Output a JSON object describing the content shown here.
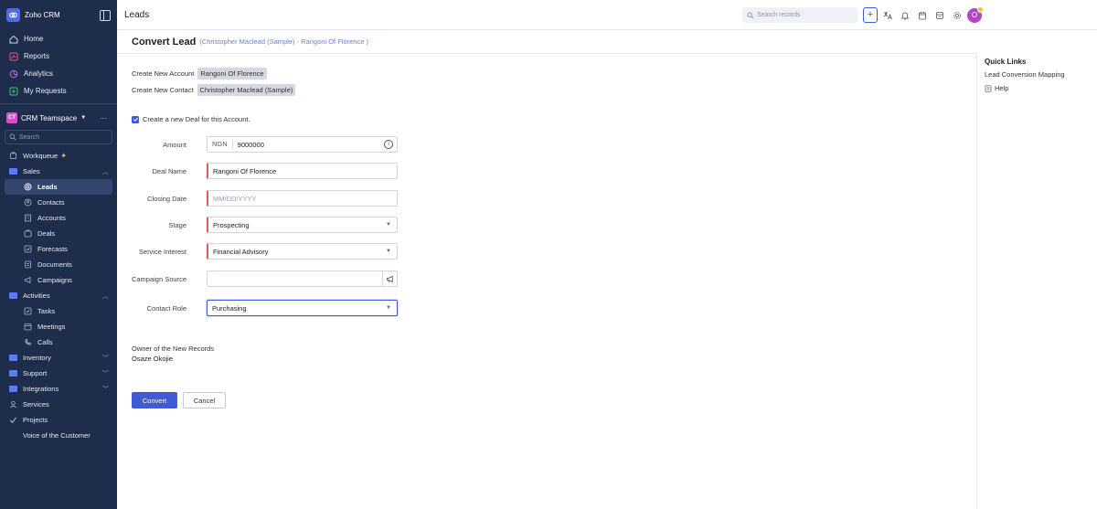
{
  "app": {
    "name": "Zoho CRM",
    "module_title": "Leads"
  },
  "nav": {
    "top_items": [
      {
        "label": "Home",
        "icon": "home-icon"
      },
      {
        "label": "Reports",
        "icon": "reports-icon"
      },
      {
        "label": "Analytics",
        "icon": "analytics-icon"
      },
      {
        "label": "My Requests",
        "icon": "requests-icon"
      }
    ],
    "teamspace": {
      "badge": "CT",
      "name": "CRM Teamspace"
    },
    "search_placeholder": "Search",
    "workqueue": "Workqueue",
    "sales": {
      "label": "Sales",
      "items": [
        "Leads",
        "Contacts",
        "Accounts",
        "Deals",
        "Forecasts",
        "Documents",
        "Campaigns"
      ],
      "active": "Leads"
    },
    "activities": {
      "label": "Activities",
      "items": [
        "Tasks",
        "Meetings",
        "Calls"
      ]
    },
    "groups": [
      "Inventory",
      "Support",
      "Integrations"
    ],
    "bottom": [
      "Services",
      "Projects",
      "Voice of the Customer"
    ]
  },
  "topbar": {
    "search_placeholder": "Search records",
    "avatar_initial": "O"
  },
  "header": {
    "title": "Convert Lead",
    "subtitle": "(Christopher Maclead (Sample) - Rangoni Of Florence )"
  },
  "quick_links": {
    "title": "Quick Links",
    "items": [
      "Lead Conversion Mapping",
      "Help"
    ]
  },
  "convert": {
    "account_label": "Create New Account",
    "account_value": "Rangoni Of Florence",
    "contact_label": "Create New Contact",
    "contact_value": "Christopher Maclead (Sample)",
    "deal_checkbox_label": "Create a new Deal for this Account.",
    "deal_checked": true,
    "fields": {
      "amount": {
        "label": "Amount",
        "currency": "NGN",
        "value": "9000000"
      },
      "deal_name": {
        "label": "Deal Name",
        "value": "Rangoni Of Florence"
      },
      "closing_date": {
        "label": "Closing Date",
        "placeholder": "MM/DD/YYYY"
      },
      "stage": {
        "label": "Stage",
        "value": "Prospecting"
      },
      "service_interest": {
        "label": "Service Interest",
        "value": "Financial Advisory"
      },
      "campaign_source": {
        "label": "Campaign Source",
        "value": ""
      },
      "contact_role": {
        "label": "Contact Role",
        "value": "Purchasing"
      }
    },
    "owner_label": "Owner of the New Records",
    "owner_name": "Osaze Okojie",
    "convert_button": "Convert",
    "cancel_button": "Cancel"
  },
  "colors": {
    "sidebar_bg": "#1f2d4d",
    "accent": "#3f5bd6",
    "required": "#e05a5a"
  }
}
